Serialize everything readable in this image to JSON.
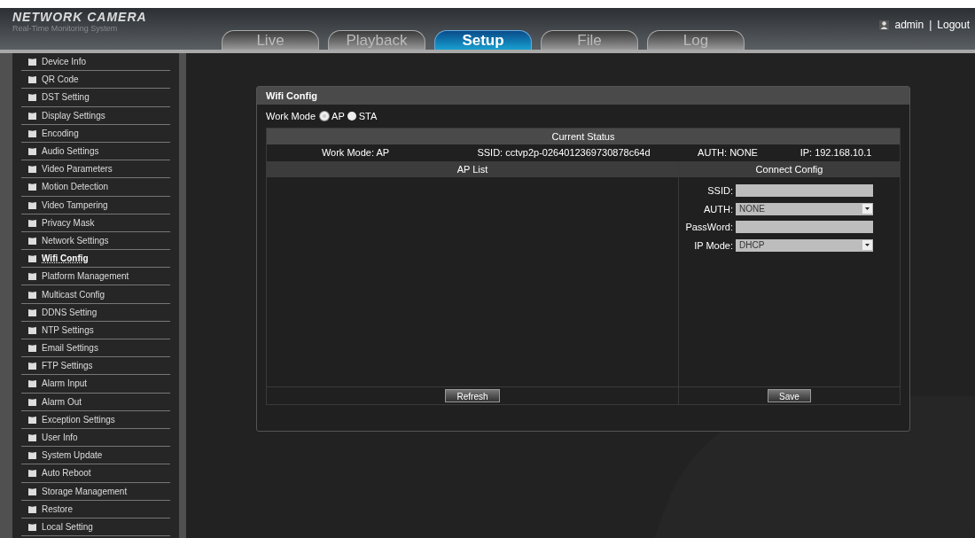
{
  "header": {
    "logo": "NETWORK CAMERA",
    "subtitle": "Real-Time Monitoring System",
    "user": "admin",
    "separator": "|",
    "logout": "Logout"
  },
  "tabs": [
    {
      "label": "Live",
      "selected": false
    },
    {
      "label": "Playback",
      "selected": false
    },
    {
      "label": "Setup",
      "selected": true
    },
    {
      "label": "File",
      "selected": false
    },
    {
      "label": "Log",
      "selected": false
    }
  ],
  "sidebar": {
    "items": [
      {
        "label": "Device Info",
        "selected": false
      },
      {
        "label": "QR Code",
        "selected": false
      },
      {
        "label": "DST Setting",
        "selected": false
      },
      {
        "label": "Display Settings",
        "selected": false
      },
      {
        "label": "Encoding",
        "selected": false
      },
      {
        "label": "Audio Settings",
        "selected": false
      },
      {
        "label": "Video Parameters",
        "selected": false
      },
      {
        "label": "Motion Detection",
        "selected": false
      },
      {
        "label": "Video Tampering",
        "selected": false
      },
      {
        "label": "Privacy Mask",
        "selected": false
      },
      {
        "label": "Network Settings",
        "selected": false
      },
      {
        "label": "Wifi Config",
        "selected": true
      },
      {
        "label": "Platform Management",
        "selected": false
      },
      {
        "label": "Multicast Config",
        "selected": false
      },
      {
        "label": "DDNS Setting",
        "selected": false
      },
      {
        "label": "NTP Settings",
        "selected": false
      },
      {
        "label": "Email Settings",
        "selected": false
      },
      {
        "label": "FTP Settings",
        "selected": false
      },
      {
        "label": "Alarm Input",
        "selected": false
      },
      {
        "label": "Alarm Out",
        "selected": false
      },
      {
        "label": "Exception Settings",
        "selected": false
      },
      {
        "label": "User Info",
        "selected": false
      },
      {
        "label": "System Update",
        "selected": false
      },
      {
        "label": "Auto Reboot",
        "selected": false
      },
      {
        "label": "Storage Management",
        "selected": false
      },
      {
        "label": "Restore",
        "selected": false
      },
      {
        "label": "Local Setting",
        "selected": false
      }
    ]
  },
  "panel": {
    "title": "Wifi Config",
    "work_mode_label": "Work Mode",
    "work_modes": [
      {
        "label": "AP",
        "selected": true
      },
      {
        "label": "STA",
        "selected": false
      }
    ],
    "current_status": {
      "title": "Current Status",
      "values": [
        "Work Mode: AP",
        "SSID: cctvp2p-0264012369730878c64d",
        "AUTH: NONE",
        "IP: 192.168.10.1"
      ]
    },
    "ap_list": {
      "title": "AP List",
      "button": "Refresh"
    },
    "connect_config": {
      "title": "Connect Config",
      "fields": [
        {
          "label": "SSID:",
          "kind": "text"
        },
        {
          "label": "AUTH:",
          "kind": "select",
          "value": "NONE"
        },
        {
          "label": "PassWord:",
          "kind": "text"
        },
        {
          "label": "IP Mode:",
          "kind": "select",
          "value": "DHCP"
        }
      ],
      "button": "Save"
    }
  }
}
